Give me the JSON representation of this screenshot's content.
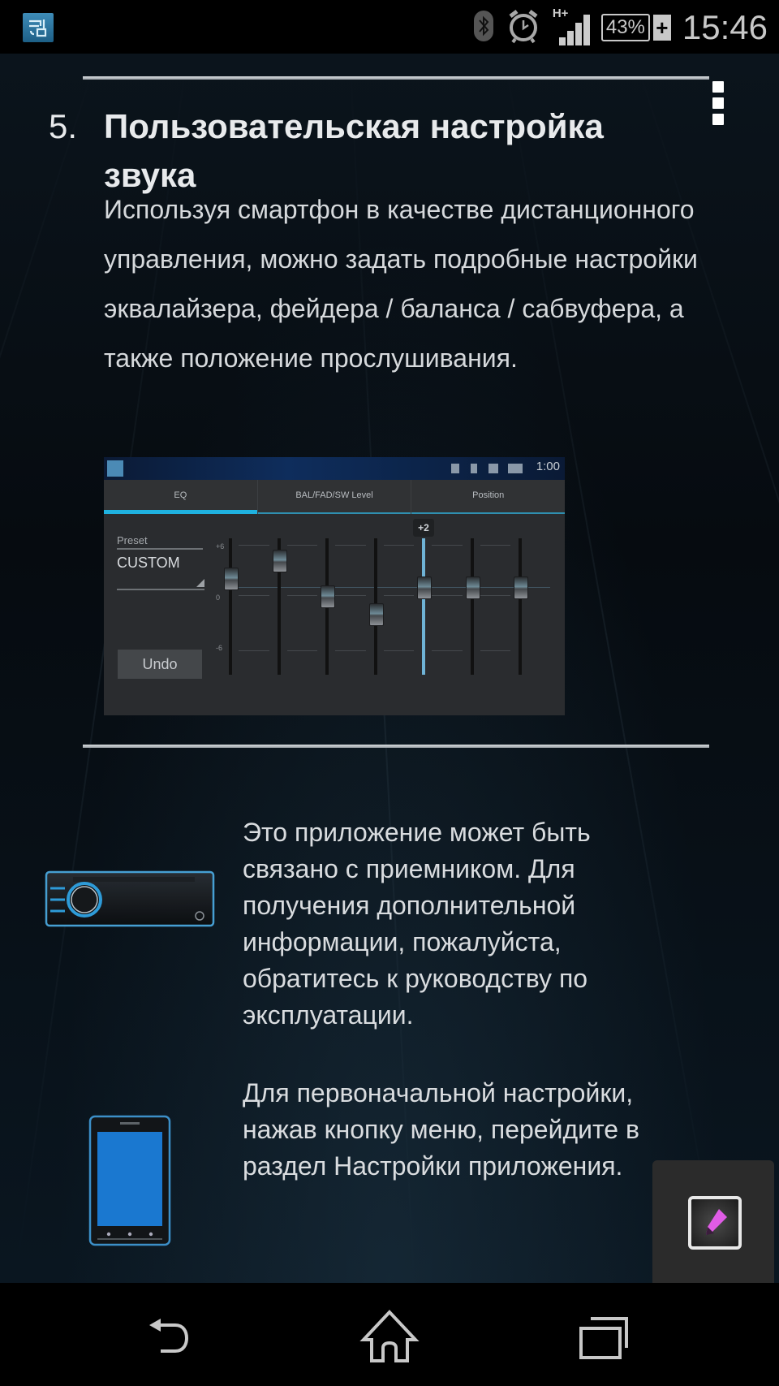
{
  "status_bar": {
    "app_icon": "car-audio-app-icon",
    "icons": [
      "bluetooth-icon",
      "alarm-icon",
      "signal-hplus-icon"
    ],
    "network_type": "H+",
    "battery_percent": "43%",
    "battery_charging": "+",
    "time": "15:46"
  },
  "section": {
    "number": "5.",
    "title": "Пользовательская настройка звука",
    "description": "Используя смартфон в качестве дистанционного управления, можно задать подробные настройки эквалайзера, фейдера / баланса / сабвуфера, а также положение прослушивания."
  },
  "eq_screenshot": {
    "status_time": "1:00",
    "tabs": [
      {
        "label": "EQ",
        "active": true
      },
      {
        "label": "BAL/FAD/SW Level",
        "active": false
      },
      {
        "label": "Position",
        "active": false
      }
    ],
    "preset_label": "Preset",
    "preset_value": "CUSTOM",
    "undo_label": "Undo",
    "scale": {
      "top": "+6",
      "mid": "0",
      "bottom": "-6",
      "min": -6,
      "max": 6
    },
    "bands": [
      {
        "value": 3,
        "selected": false
      },
      {
        "value": 5,
        "selected": false
      },
      {
        "value": 1,
        "selected": false
      },
      {
        "value": -1,
        "selected": false
      },
      {
        "value": 2,
        "selected": true
      },
      {
        "value": 2,
        "selected": false
      },
      {
        "value": 2,
        "selected": false
      }
    ],
    "selected_value_label": "+2"
  },
  "info_rows": [
    {
      "icon": "car-receiver-icon",
      "text": "Это приложение может быть связано с приемником. Для получения дополнительной информации, пожалуйста, обратитесь к руководству по эксплуатации."
    },
    {
      "icon": "smartphone-icon",
      "text": "Для первоначальной настройки, нажав кнопку меню, перейдите в раздел Настройки приложения."
    }
  ],
  "floating_button": {
    "icon": "edit-pencil-icon",
    "accent": "#e05ce6"
  },
  "nav_bar": {
    "buttons": [
      "back",
      "home",
      "recent-apps"
    ]
  },
  "colors": {
    "background": "#060b10",
    "text": "#d9dcdf",
    "eq_accent": "#1fb2e0"
  }
}
